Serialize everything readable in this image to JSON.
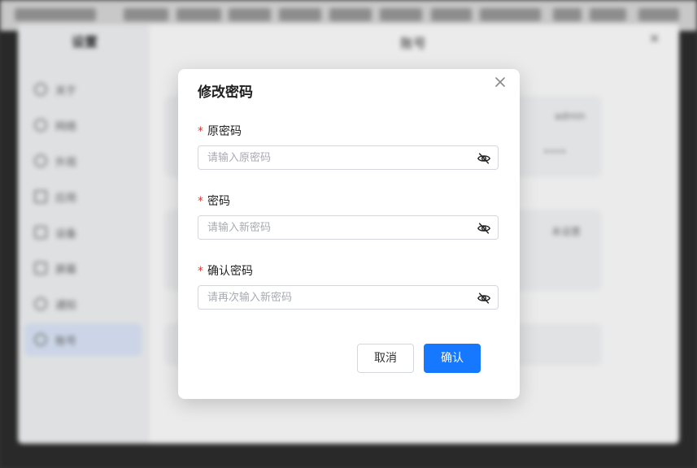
{
  "background": {
    "sidebar": {
      "title": "设置",
      "items": [
        {
          "label": "关于",
          "icon": "info-icon"
        },
        {
          "label": "网络",
          "icon": "user-icon"
        },
        {
          "label": "外观",
          "icon": "palette-icon"
        },
        {
          "label": "应用",
          "icon": "grid-icon"
        },
        {
          "label": "设备",
          "icon": "device-icon"
        },
        {
          "label": "屏幕",
          "icon": "monitor-icon"
        },
        {
          "label": "通知",
          "icon": "bell-icon"
        },
        {
          "label": "账号",
          "icon": "user-icon"
        }
      ]
    },
    "main": {
      "title": "账号",
      "card1_text_a": "admin",
      "card1_text_b": "••••",
      "card2_text": "未设置"
    }
  },
  "dialog": {
    "title": "修改密码",
    "required_mark": "*",
    "fields": [
      {
        "label": "原密码",
        "placeholder": "请输入原密码"
      },
      {
        "label": "密码",
        "placeholder": "请输入新密码"
      },
      {
        "label": "确认密码",
        "placeholder": "请再次输入新密码"
      }
    ],
    "cancel_label": "取消",
    "confirm_label": "确认"
  },
  "colors": {
    "primary": "#1677ff",
    "required": "#e0342f",
    "border": "#d4d7de",
    "placeholder": "#a8abb2"
  }
}
